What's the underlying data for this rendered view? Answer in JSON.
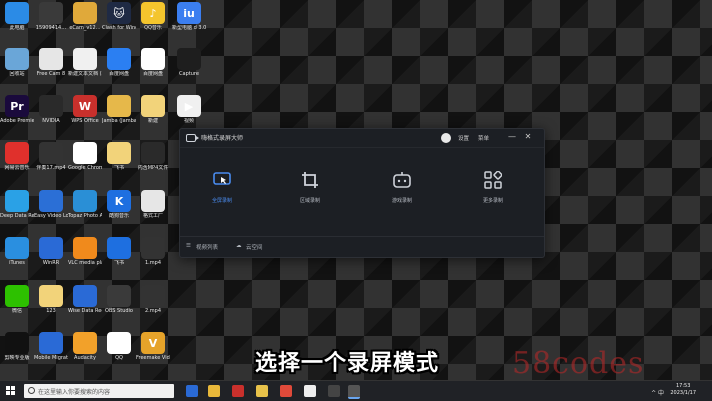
{
  "desktop_icons": [
    {
      "label": "此电脑",
      "color": "#2b8be6",
      "glyph": ""
    },
    {
      "label": "15909414…",
      "color": "#3a3a3a",
      "glyph": ""
    },
    {
      "label": "eCam_v12…",
      "color": "#e0a93a",
      "glyph": ""
    },
    {
      "label": "Clash for Windows",
      "color": "#1f2a44",
      "glyph": "🐱"
    },
    {
      "label": "QQ音乐",
      "color": "#f4c52d",
      "glyph": "♪"
    },
    {
      "label": "新型电脑 d 3.0.0.4…",
      "color": "#3b7ef0",
      "glyph": "iu"
    },
    {
      "label": "回收站",
      "color": "#6aa6d8",
      "glyph": ""
    },
    {
      "label": "Free Cam 8",
      "color": "#e6e6e6",
      "glyph": ""
    },
    {
      "label": "新建文本文档 (2)",
      "color": "#f0f0f0",
      "glyph": ""
    },
    {
      "label": "百度网盘",
      "color": "#2b7ff2",
      "glyph": ""
    },
    {
      "label": "百度网盘",
      "color": "#ffffff",
      "glyph": ""
    },
    {
      "label": "Capture",
      "color": "#1e1e1e",
      "glyph": ""
    },
    {
      "label": "Adobe Premie…",
      "color": "#1a0a3c",
      "glyph": "Pr"
    },
    {
      "label": "NVIDIA",
      "color": "#2a2a2a",
      "glyph": ""
    },
    {
      "label": "WPS Office",
      "color": "#c9302c",
      "glyph": "W"
    },
    {
      "label": "Jamba (Jamba 9)",
      "color": "#e6b84a",
      "glyph": ""
    },
    {
      "label": "新建",
      "color": "#f2d37a",
      "glyph": ""
    },
    {
      "label": "视频",
      "color": "#f0f0f0",
      "glyph": "▶"
    },
    {
      "label": "网易云音乐",
      "color": "#e0302c",
      "glyph": ""
    },
    {
      "label": "伴奏17.mp4",
      "color": "#333",
      "glyph": ""
    },
    {
      "label": "Google Chrome",
      "color": "#ffffff",
      "glyph": ""
    },
    {
      "label": "飞书",
      "color": "#f2d37a",
      "glyph": ""
    },
    {
      "label": "内含MP4文件",
      "color": "#2a2a2a",
      "glyph": ""
    },
    {
      "label": "Deep Data Recovery",
      "color": "#2aa1e6",
      "glyph": ""
    },
    {
      "label": "Easy Video Logo Rem…",
      "color": "#2b6fd6",
      "glyph": ""
    },
    {
      "label": "Topaz Photo AI",
      "color": "#2a8fd6",
      "glyph": ""
    },
    {
      "label": "酷狗音乐",
      "color": "#1e6fe0",
      "glyph": "K"
    },
    {
      "label": "格式工厂",
      "color": "#e6e6e6",
      "glyph": ""
    },
    {
      "label": "iTunes",
      "color": "#2a8fe0",
      "glyph": ""
    },
    {
      "label": "WinRR",
      "color": "#2a6ad6",
      "glyph": ""
    },
    {
      "label": "VLC media player",
      "color": "#f08a1c",
      "glyph": ""
    },
    {
      "label": "飞书",
      "color": "#1e6fe0",
      "glyph": ""
    },
    {
      "label": "1.mp4",
      "color": "#333",
      "glyph": ""
    },
    {
      "label": "微信",
      "color": "#2dc100",
      "glyph": ""
    },
    {
      "label": "123",
      "color": "#f2d37a",
      "glyph": ""
    },
    {
      "label": "Wise Data Recovery",
      "color": "#2a6ad6",
      "glyph": ""
    },
    {
      "label": "OBS Studio",
      "color": "#3a3a3a",
      "glyph": ""
    },
    {
      "label": "2.mp4",
      "color": "#333",
      "glyph": ""
    },
    {
      "label": "剪映专业版",
      "color": "#111",
      "glyph": ""
    },
    {
      "label": "Mobile Migration…",
      "color": "#2a6ad6",
      "glyph": ""
    },
    {
      "label": "Audacity",
      "color": "#f2a12a",
      "glyph": ""
    },
    {
      "label": "QQ",
      "color": "#ffffff",
      "glyph": ""
    },
    {
      "label": "Freemake Video…",
      "color": "#e6a32a",
      "glyph": "V"
    }
  ],
  "recorder": {
    "title": "嗨格式录屏大师",
    "settings_link": "设置",
    "account_link": "菜单",
    "minimize": "—",
    "close": "✕",
    "modes": [
      {
        "label": "全屏录制",
        "icon": "fullscreen-record-icon",
        "active": true
      },
      {
        "label": "区域录制",
        "icon": "crop-icon",
        "active": false
      },
      {
        "label": "游戏录制",
        "icon": "gamepad-icon",
        "active": false
      },
      {
        "label": "更多录制",
        "icon": "more-grid-icon",
        "active": false
      }
    ],
    "footer_list": "视频列表",
    "footer_cloud": "云空间"
  },
  "subtitle": "选择一个录屏模式",
  "watermark": "58codes",
  "taskbar": {
    "search_placeholder": "在这里输入你要搜索的内容",
    "time": "17:53",
    "date": "2023/1/17",
    "tray_text": "^ 中"
  }
}
